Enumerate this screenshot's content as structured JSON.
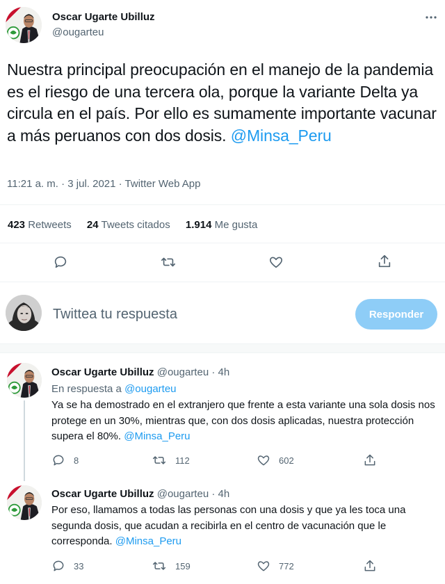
{
  "tweet": {
    "author_name": "Oscar Ugarte Ubilluz",
    "author_handle": "@ougarteu",
    "text": "Nuestra principal preocupación en el manejo de la pandemia es el riesgo de una tercera ola, porque la variante Delta ya circula en el país. Por ello es sumamente importante vacunar a más peruanos con dos dosis.",
    "mention": "@Minsa_Peru",
    "timestamp": "11:21 a. m. · 3 jul. 2021 · Twitter Web App",
    "retweets_count": "423",
    "retweets_label": "Retweets",
    "quotes_count": "24",
    "quotes_label": "Tweets citados",
    "likes_count": "1.914",
    "likes_label": "Me gusta",
    "icons": [
      "reply-icon",
      "retweet-icon",
      "like-icon",
      "share-icon"
    ]
  },
  "compose": {
    "placeholder": "Twittea tu respuesta",
    "button_label": "Responder"
  },
  "replies": [
    {
      "author_name": "Oscar Ugarte Ubilluz",
      "author_handle": "@ougarteu",
      "age": "· 4h",
      "in_reply_prefix": "En respuesta a",
      "in_reply_handle": "@ougarteu",
      "text": "Ya se ha demostrado en el extranjero que frente a esta variante una sola dosis nos protege en un 30%, mientras que, con dos dosis aplicadas, nuestra protección supera el 80%.",
      "mention": "@Minsa_Peru",
      "replies_count": "8",
      "retweets_count": "112",
      "likes_count": "602"
    },
    {
      "author_name": "Oscar Ugarte Ubilluz",
      "author_handle": "@ougarteu",
      "age": "· 4h",
      "text": "Por eso, llamamos a todas las personas con una dosis y que ya les toca una segunda dosis, que acudan a recibirla en el centro de vacunación que le corresponda.",
      "mention": "@Minsa_Peru",
      "replies_count": "33",
      "retweets_count": "159",
      "likes_count": "772"
    }
  ],
  "colors": {
    "link": "#1d9bf0",
    "muted": "#536471",
    "button_disabled": "#8ecdf7"
  }
}
